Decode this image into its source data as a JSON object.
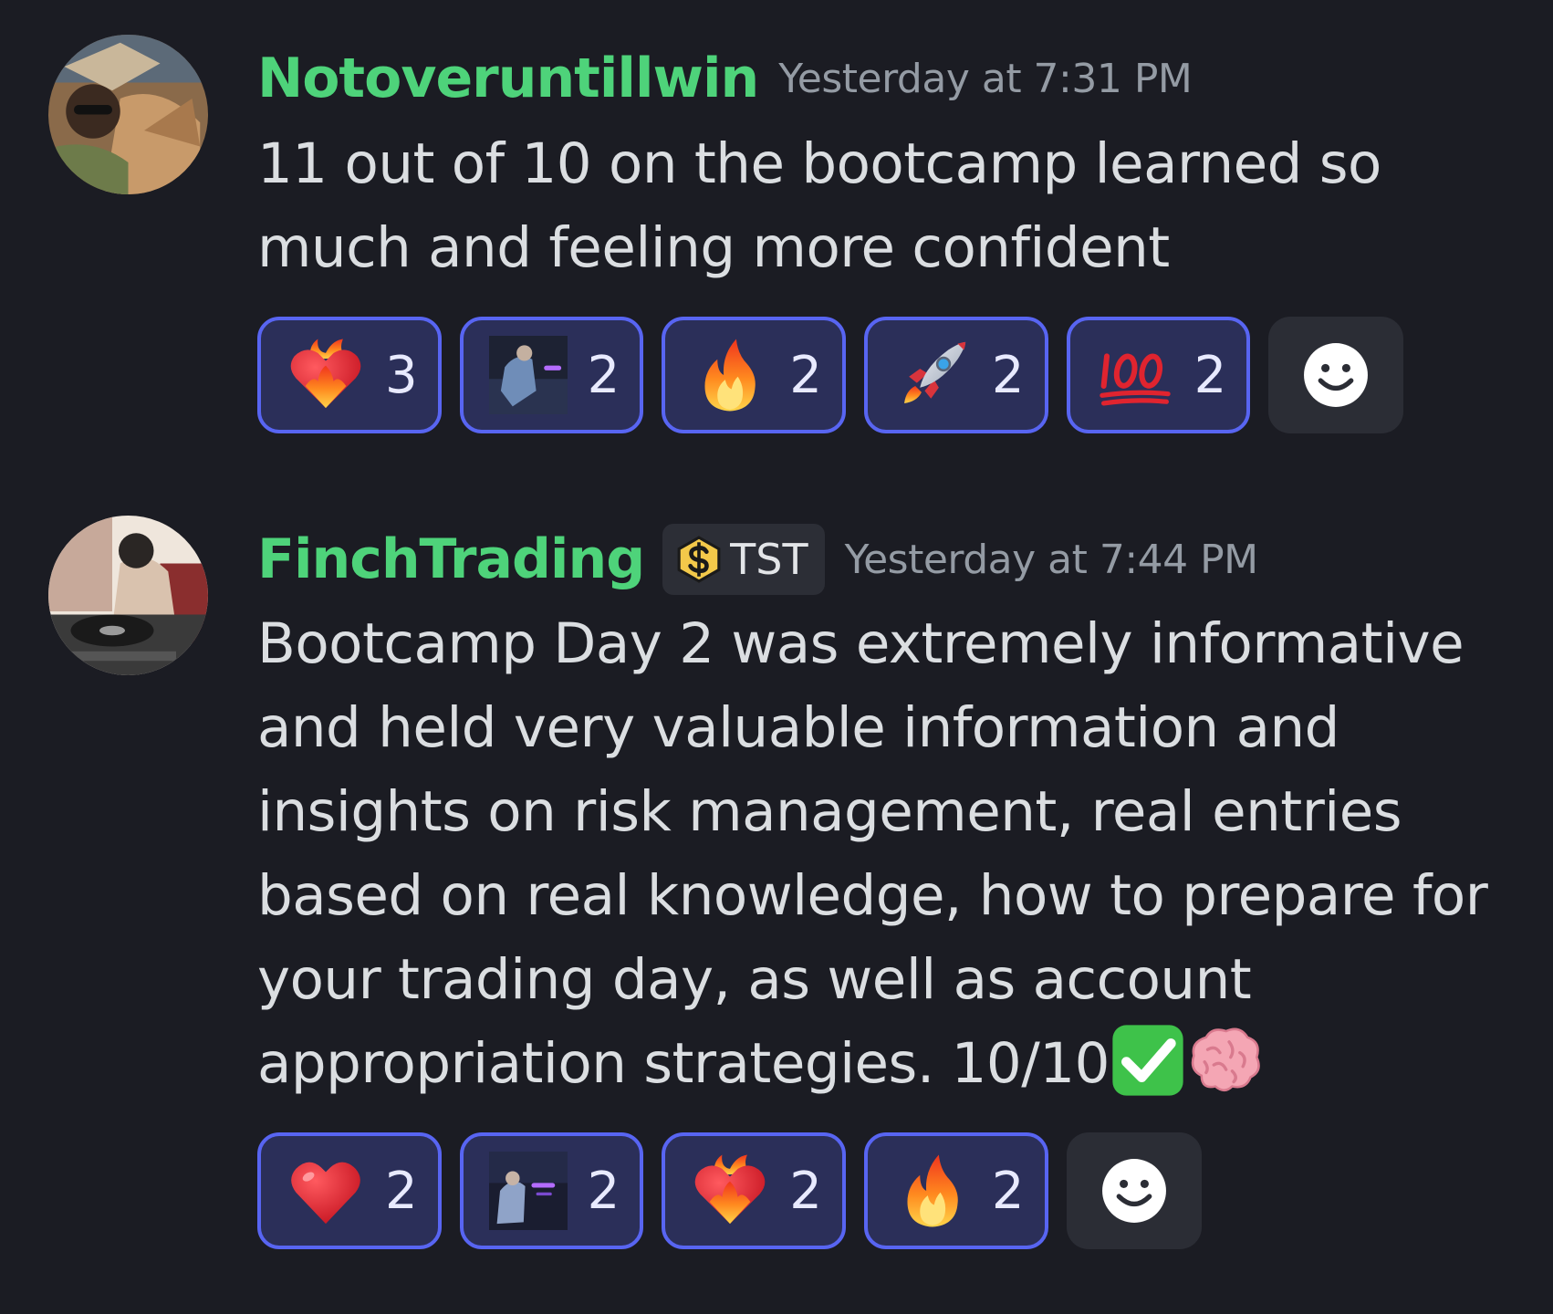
{
  "messages": [
    {
      "author": "Notoveruntillwin",
      "author_color": "#4ed37a",
      "timestamp": "Yesterday at 7:31 PM",
      "avatar_icon": "avatar-photo",
      "text": "11 out of 10 on the bootcamp learned so much and feeling more confident",
      "reactions": [
        {
          "emoji": "heart-on-fire-emoji",
          "count": "3"
        },
        {
          "emoji": "custom-image-emoji",
          "count": "2"
        },
        {
          "emoji": "fire-emoji",
          "count": "2"
        },
        {
          "emoji": "rocket-emoji",
          "count": "2"
        },
        {
          "emoji": "hundred-points-emoji",
          "count": "2"
        }
      ],
      "add_reaction_icon": "smiley-add-reaction-icon"
    },
    {
      "author": "FinchTrading",
      "author_color": "#4ed37a",
      "tag": "TST",
      "tag_icon": "dollar-badge-icon",
      "timestamp": "Yesterday at 7:44 PM",
      "avatar_icon": "avatar-illustration",
      "text": "Bootcamp Day 2 was extremely informative and held very valuable information and insights on risk management, real entries based on real knowledge, how to prepare for your trading day, as well as account appropriation strategies. 10/10",
      "trailing_emojis": [
        "check-mark-button-emoji",
        "brain-emoji"
      ],
      "reactions": [
        {
          "emoji": "red-heart-emoji",
          "count": "2"
        },
        {
          "emoji": "custom-image-emoji",
          "count": "2"
        },
        {
          "emoji": "heart-on-fire-emoji",
          "count": "2"
        },
        {
          "emoji": "fire-emoji",
          "count": "2"
        }
      ],
      "add_reaction_icon": "smiley-add-reaction-icon"
    }
  ],
  "colors": {
    "background": "#1b1c23",
    "reaction_border": "#5865f2",
    "reaction_fill": "#2b2f59",
    "timestamp": "#949ba4"
  }
}
